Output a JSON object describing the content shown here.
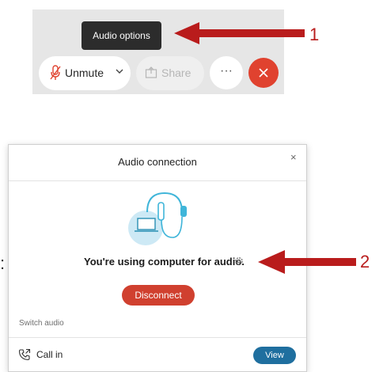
{
  "toolbar": {
    "tooltip": "Audio options",
    "unmute_label": "Unmute",
    "share_label": "Share",
    "more_label": "···",
    "colors": {
      "leave": "#e0422f",
      "toolbar_bg": "#e6e6e6"
    }
  },
  "annotations": {
    "step1": "1",
    "step2": "2",
    "arrow_color": "#b91c1c"
  },
  "dialog": {
    "title": "Audio connection",
    "close_label": "×",
    "status": "You're using computer for audio.",
    "disconnect_label": "Disconnect",
    "switch_label": "Switch audio",
    "call_in_label": "Call in",
    "view_label": "View",
    "colors": {
      "disconnect": "#d0402f",
      "view": "#1f6f9f",
      "illustration": "#3fb5d9"
    }
  },
  "background_fragment": ":"
}
